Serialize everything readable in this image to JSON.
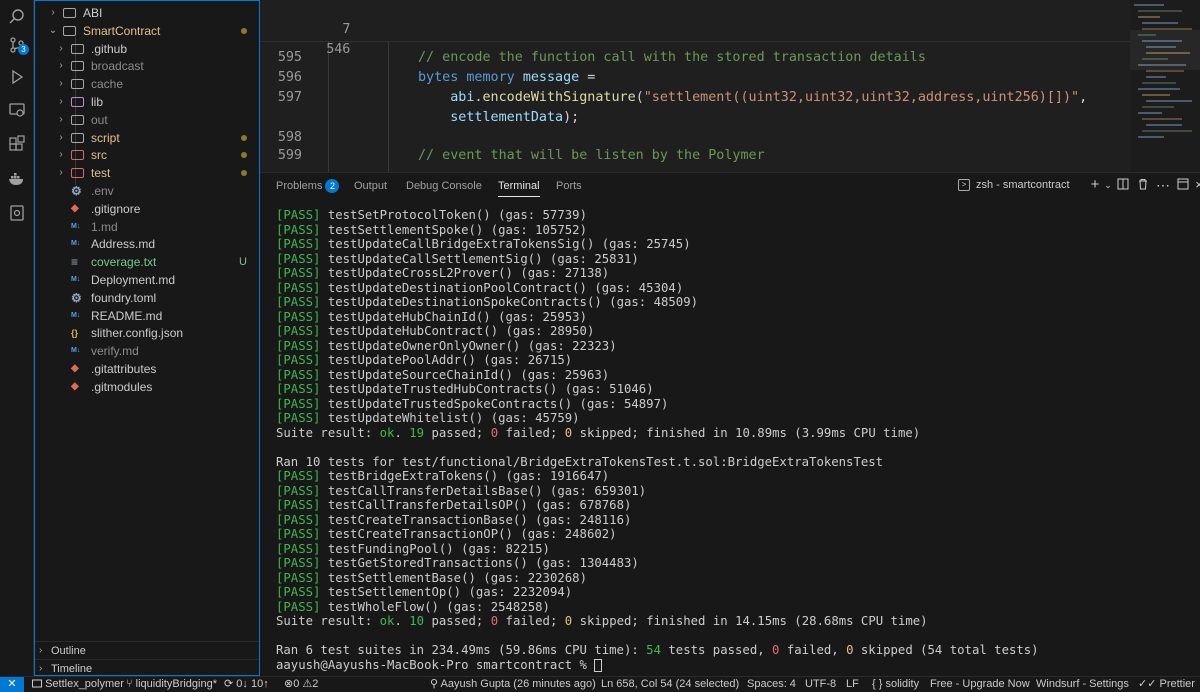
{
  "activity_bar": {
    "icons": [
      "search-icon",
      "source-control-icon",
      "run-debug-icon",
      "remote-explorer-icon",
      "extensions-icon",
      "docker-icon",
      "accounts-settings-icon"
    ],
    "scm_badge": "3"
  },
  "explorer": {
    "items": [
      {
        "label": "ABI",
        "kind": "folder",
        "chev": "›",
        "color": "#cccccc"
      },
      {
        "label": "SmartContract",
        "kind": "folder-open",
        "chev": "⌄",
        "color": "#e2c08d",
        "deco": "dot"
      },
      {
        "label": ".github",
        "kind": "folder",
        "chev": "›",
        "color": "#cccccc"
      },
      {
        "label": "broadcast",
        "kind": "folder",
        "chev": "›",
        "color": "#8c8c8c"
      },
      {
        "label": "cache",
        "kind": "folder",
        "chev": "›",
        "color": "#8c8c8c"
      },
      {
        "label": "lib",
        "kind": "folder",
        "chev": "›",
        "color": "#cccccc"
      },
      {
        "label": "out",
        "kind": "folder",
        "chev": "›",
        "color": "#8c8c8c"
      },
      {
        "label": "script",
        "kind": "folder",
        "chev": "›",
        "color": "#e2c08d",
        "deco": "dot"
      },
      {
        "label": "src",
        "kind": "folder",
        "chev": "›",
        "color": "#e2c08d",
        "deco": "dot"
      },
      {
        "label": "test",
        "kind": "folder",
        "chev": "›",
        "color": "#e2c08d",
        "deco": "dot"
      },
      {
        "label": ".env",
        "kind": "file",
        "icon": "gear",
        "color": "#8c8c8c"
      },
      {
        "label": ".gitignore",
        "kind": "file",
        "icon": "git",
        "color": "#cccccc"
      },
      {
        "label": "1.md",
        "kind": "file",
        "icon": "md",
        "color": "#8c8c8c"
      },
      {
        "label": "Address.md",
        "kind": "file",
        "icon": "md",
        "color": "#cccccc"
      },
      {
        "label": "coverage.txt",
        "kind": "file",
        "icon": "txt",
        "color": "#73c991",
        "deco": "U"
      },
      {
        "label": "Deployment.md",
        "kind": "file",
        "icon": "md",
        "color": "#cccccc"
      },
      {
        "label": "foundry.toml",
        "kind": "file",
        "icon": "gear",
        "color": "#cccccc"
      },
      {
        "label": "README.md",
        "kind": "file",
        "icon": "md",
        "color": "#cccccc"
      },
      {
        "label": "slither.config.json",
        "kind": "file",
        "icon": "json",
        "color": "#cccccc"
      },
      {
        "label": "verify.md",
        "kind": "file",
        "icon": "md",
        "color": "#8c8c8c"
      },
      {
        "label": ".gitattributes",
        "kind": "file",
        "icon": "git",
        "color": "#cccccc"
      },
      {
        "label": ".gitmodules",
        "kind": "file",
        "icon": "git",
        "color": "#cccccc"
      }
    ],
    "outline_label": "Outline",
    "timeline_label": "Timeline"
  },
  "editor": {
    "sticky": [
      {
        "ln": "7",
        "code": ""
      },
      {
        "ln": "546",
        "code": ""
      }
    ],
    "lines": [
      {
        "ln": "595",
        "tokens": [
          {
            "t": "// encode the function call with the stored transaction details",
            "c": "c-comment"
          }
        ]
      },
      {
        "ln": "596",
        "tokens": [
          {
            "t": "bytes",
            "c": "c-kw"
          },
          {
            "t": " ",
            "c": "c-plain"
          },
          {
            "t": "memory",
            "c": "c-kw"
          },
          {
            "t": " ",
            "c": "c-plain"
          },
          {
            "t": "message",
            "c": "c-var"
          },
          {
            "t": " =",
            "c": "c-plain"
          }
        ]
      },
      {
        "ln": "597",
        "tokens": [
          {
            "t": "    abi",
            "c": "c-var"
          },
          {
            "t": ".",
            "c": "c-plain"
          },
          {
            "t": "encodeWithSignature",
            "c": "c-fn"
          },
          {
            "t": "(",
            "c": "c-plain"
          },
          {
            "t": "\"settlement((uint32,uint32,uint32,address,uint256)[])\"",
            "c": "c-str"
          },
          {
            "t": ",",
            "c": "c-plain"
          }
        ]
      },
      {
        "ln": "",
        "tokens": [
          {
            "t": "    settlementData",
            "c": "c-var"
          },
          {
            "t": ");",
            "c": "c-plain"
          }
        ]
      },
      {
        "ln": "598",
        "tokens": []
      },
      {
        "ln": "599",
        "tokens": [
          {
            "t": "// event that will be listen by the Polymer",
            "c": "c-comment"
          }
        ]
      }
    ]
  },
  "panel": {
    "tabs": [
      {
        "label": "Problems",
        "badge": "2"
      },
      {
        "label": "Output"
      },
      {
        "label": "Debug Console"
      },
      {
        "label": "Terminal",
        "active": true
      },
      {
        "label": "Ports"
      }
    ],
    "terminal_name": "zsh - smartcontract"
  },
  "terminal": {
    "block1": [
      {
        "name": "testSetProtocolToken()",
        "gas": "57739"
      },
      {
        "name": "testSettlementSpoke()",
        "gas": "105752"
      },
      {
        "name": "testUpdateCallBridgeExtraTokensSig()",
        "gas": "25745"
      },
      {
        "name": "testUpdateCallSettlementSig()",
        "gas": "25831"
      },
      {
        "name": "testUpdateCrossL2Prover()",
        "gas": "27138"
      },
      {
        "name": "testUpdateDestinationPoolContract()",
        "gas": "45304"
      },
      {
        "name": "testUpdateDestinationSpokeContracts()",
        "gas": "48509"
      },
      {
        "name": "testUpdateHubChainId()",
        "gas": "25953"
      },
      {
        "name": "testUpdateHubContract()",
        "gas": "28950"
      },
      {
        "name": "testUpdateOwnerOnlyOwner()",
        "gas": "22323"
      },
      {
        "name": "testUpdatePoolAddr()",
        "gas": "26715"
      },
      {
        "name": "testUpdateSourceChainId()",
        "gas": "25963"
      },
      {
        "name": "testUpdateTrustedHubContracts()",
        "gas": "51046"
      },
      {
        "name": "testUpdateTrustedSpokeContracts()",
        "gas": "54897"
      },
      {
        "name": "testUpdateWhitelist()",
        "gas": "45759"
      }
    ],
    "suite1": {
      "passed": "19",
      "failed": "0",
      "skipped": "0",
      "finished": "finished in 10.89ms (3.99ms CPU time)"
    },
    "ran2": "Ran 10 tests for test/functional/BridgeExtraTokensTest.t.sol:BridgeExtraTokensTest",
    "block2": [
      {
        "name": "testBridgeExtraTokens()",
        "gas": "1916647"
      },
      {
        "name": "testCallTransferDetailsBase()",
        "gas": "659301"
      },
      {
        "name": "testCallTransferDetailsOP()",
        "gas": "678768"
      },
      {
        "name": "testCreateTransactionBase()",
        "gas": "248116"
      },
      {
        "name": "testCreateTransactionOP()",
        "gas": "248602"
      },
      {
        "name": "testFundingPool()",
        "gas": "82215"
      },
      {
        "name": "testGetStoredTransactions()",
        "gas": "1304483"
      },
      {
        "name": "testSettlementBase()",
        "gas": "2230268"
      },
      {
        "name": "testSettlementOp()",
        "gas": "2232094"
      },
      {
        "name": "testWholeFlow()",
        "gas": "2548258"
      }
    ],
    "suite2": {
      "passed": "10",
      "failed": "0",
      "skipped": "0",
      "finished": "finished in 14.15ms (28.68ms CPU time)"
    },
    "summary": {
      "prefix": "Ran 6 test suites in 234.49ms (59.86ms CPU time): ",
      "passed": "54",
      "mid1": " tests passed, ",
      "failed": "0",
      "mid2": " failed, ",
      "skipped": "0",
      "suffix": " skipped (54 total tests)"
    },
    "prompt": "aayush@Aayushs-MacBook-Pro smartcontract % "
  },
  "statusbar": {
    "remote": "✕",
    "project": "Settlex_polymer",
    "branch": "liquidityBridging*",
    "sync": "0↓ 10↑",
    "problems": "0",
    "warnings": "2",
    "blame": "Aayush Gupta (26 minutes ago)",
    "position": "Ln 658, Col 54 (24 selected)",
    "spaces": "Spaces: 4",
    "encoding": "UTF-8",
    "eol": "LF",
    "language": "solidity",
    "upgrade": "Free - Upgrade Now",
    "windsurf": "Windsurf - Settings",
    "prettier": "Prettier"
  }
}
